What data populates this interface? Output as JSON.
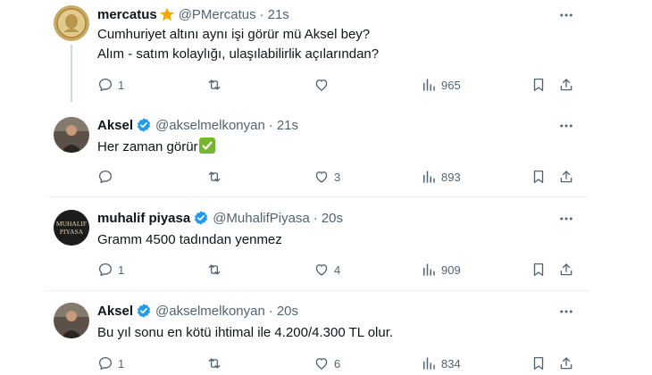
{
  "tweets": [
    {
      "name": "mercatus",
      "has_star": true,
      "verified": false,
      "handle": "@PMercatus",
      "separator": "·",
      "time": "21s",
      "lines": [
        "Cumhuriyet altını aynı işi görür mü Aksel bey?",
        "Alım - satım kolaylığı, ulaşılabilirlik açılarından?"
      ],
      "replies": "1",
      "retweets": "",
      "likes": "",
      "views": "965"
    },
    {
      "name": "Aksel",
      "has_star": false,
      "verified": true,
      "handle": "@akselmelkonyan",
      "separator": "·",
      "time": "21s",
      "lines": [
        "Her zaman görür"
      ],
      "replies": "",
      "retweets": "",
      "likes": "3",
      "views": "893"
    },
    {
      "name": "muhalif piyasa",
      "has_star": false,
      "verified": true,
      "handle": "@MuhalifPiyasa",
      "separator": "·",
      "time": "20s",
      "lines": [
        "Gramm 4500 tadından yenmez"
      ],
      "replies": "1",
      "retweets": "",
      "likes": "4",
      "views": "909"
    },
    {
      "name": "Aksel",
      "has_star": false,
      "verified": true,
      "handle": "@akselmelkonyan",
      "separator": "·",
      "time": "20s",
      "lines": [
        "Bu yıl sonu en kötü ihtimal ile 4.200/4.300 TL olur."
      ],
      "replies": "1",
      "retweets": "",
      "likes": "6",
      "views": "834"
    }
  ],
  "avatar_logo_text": "MUHALIF PIYASA",
  "colors": {
    "text": "#0f1419",
    "muted": "#536471",
    "verified_blue": "#1d9bf0",
    "star_orange": "#f7a800",
    "check_green": "#74b72e",
    "divider": "#eff3f4"
  }
}
